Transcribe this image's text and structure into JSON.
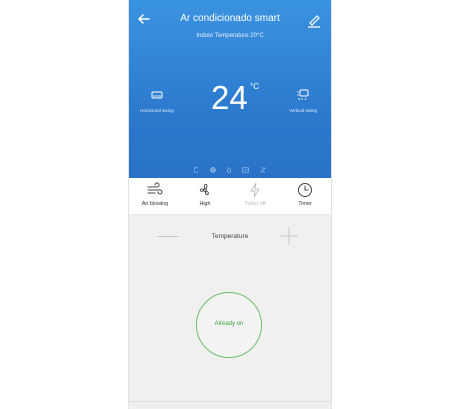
{
  "header": {
    "title": "Ar condicionado smart",
    "indoor_temperature": "Indoor Temperature 20°C",
    "back_icon": "back-arrow-icon",
    "edit_icon": "pencil-icon"
  },
  "display": {
    "setpoint": "24",
    "unit": "°C",
    "left_control": {
      "label": "Horizontal swing",
      "icon": "horizontal-swing-icon"
    },
    "right_control": {
      "label": "Vertical swing",
      "icon": "vertical-swing-icon"
    },
    "status_icons": [
      "cool-mode-icon",
      "fan-icon",
      "dry-icon",
      "display-icon",
      "sleep-icon"
    ]
  },
  "modes": [
    {
      "label": "Air blowing",
      "icon": "wind-icon",
      "enabled": true
    },
    {
      "label": "High",
      "icon": "fan-icon",
      "enabled": true
    },
    {
      "label": "Turbo off",
      "icon": "turbo-bolt-icon",
      "enabled": false
    },
    {
      "label": "Timer",
      "icon": "clock-icon",
      "enabled": true
    }
  ],
  "temperature_control": {
    "label": "Temperature"
  },
  "power": {
    "label": "Already on"
  },
  "colors": {
    "header_top": "#3a93e0",
    "header_bottom": "#2a72c8",
    "power_green": "#3fa33f",
    "background": "#f0f0f0"
  }
}
